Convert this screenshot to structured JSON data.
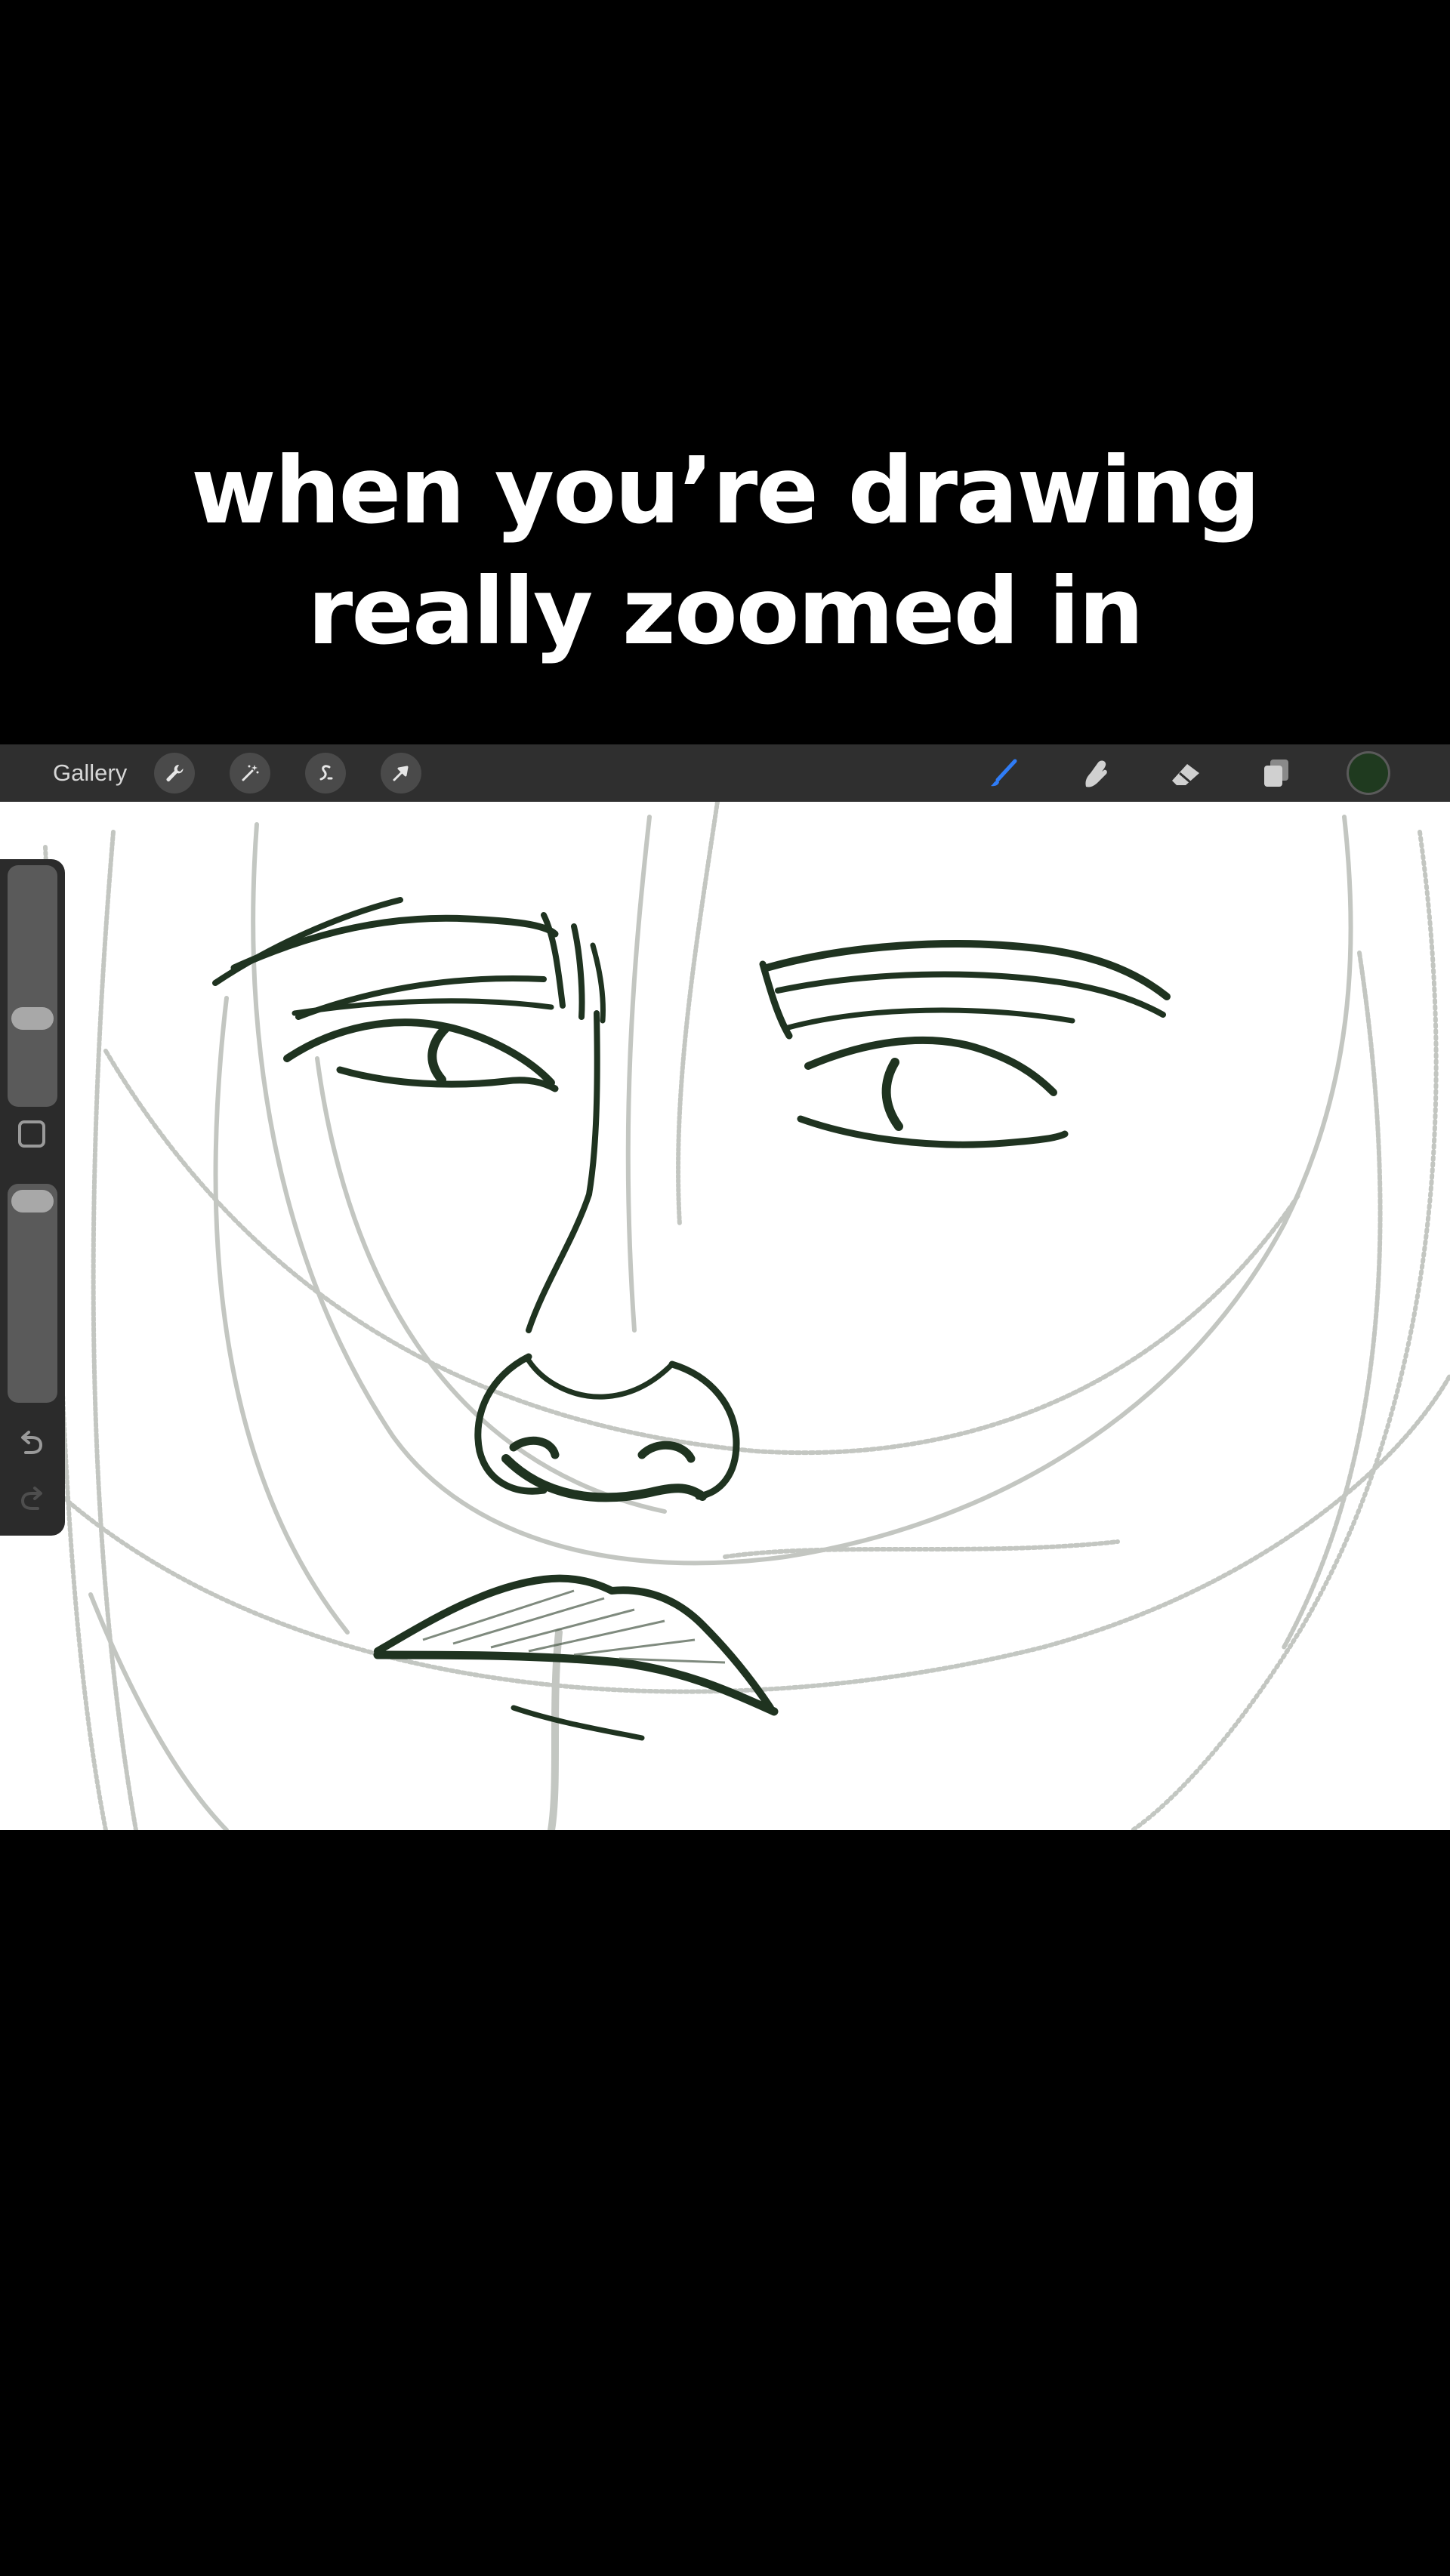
{
  "caption": {
    "line1": "when you’re drawing",
    "line2": "really zoomed in"
  },
  "toolbar": {
    "gallery_label": "Gallery",
    "left_tools": [
      "wrench-icon",
      "magic-wand-icon",
      "selection-icon",
      "transform-arrow-icon"
    ],
    "right_tools": [
      "brush-icon",
      "smudge-icon",
      "eraser-icon",
      "layers-icon"
    ],
    "active_tool": "brush-icon",
    "active_tool_color": "#2f7cf6",
    "current_color": "#1f3a1f"
  },
  "sidebar": {
    "brush_size_level": 0.2,
    "opacity_level": 0.95,
    "icons": [
      "modify-square-icon",
      "undo-icon",
      "redo-icon"
    ]
  },
  "canvas": {
    "background": "#ffffff",
    "ink_color": "#1f3320",
    "sketch_color": "#b9bdb7"
  }
}
